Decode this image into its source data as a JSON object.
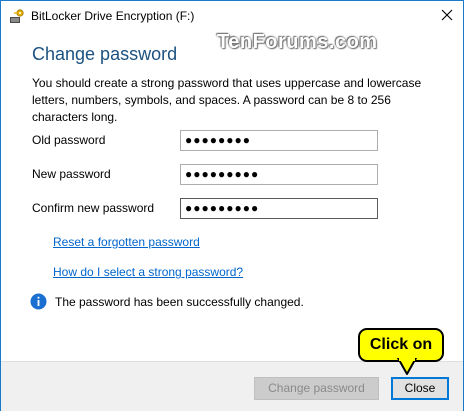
{
  "window": {
    "title": "BitLocker Drive Encryption (F:)"
  },
  "watermark": "TenForums.com",
  "heading": "Change password",
  "description": "You should create a strong password that uses uppercase and lowercase letters, numbers, symbols, and spaces. A password can be 8 to 256 characters long.",
  "fields": {
    "old": {
      "label": "Old password",
      "value": "●●●●●●●●"
    },
    "new": {
      "label": "New password",
      "value": "●●●●●●●●●"
    },
    "confirm": {
      "label": "Confirm new password",
      "value": "●●●●●●●●●"
    }
  },
  "links": {
    "reset": "Reset a forgotten password",
    "help": "How do I select a strong password?"
  },
  "status": "The password has been successfully changed.",
  "buttons": {
    "change": "Change password",
    "close": "Close"
  },
  "callout": "Click on",
  "colors": {
    "accent": "#0078d7",
    "link": "#0066cc",
    "heading": "#1c5180",
    "callout": "#ffff00"
  }
}
